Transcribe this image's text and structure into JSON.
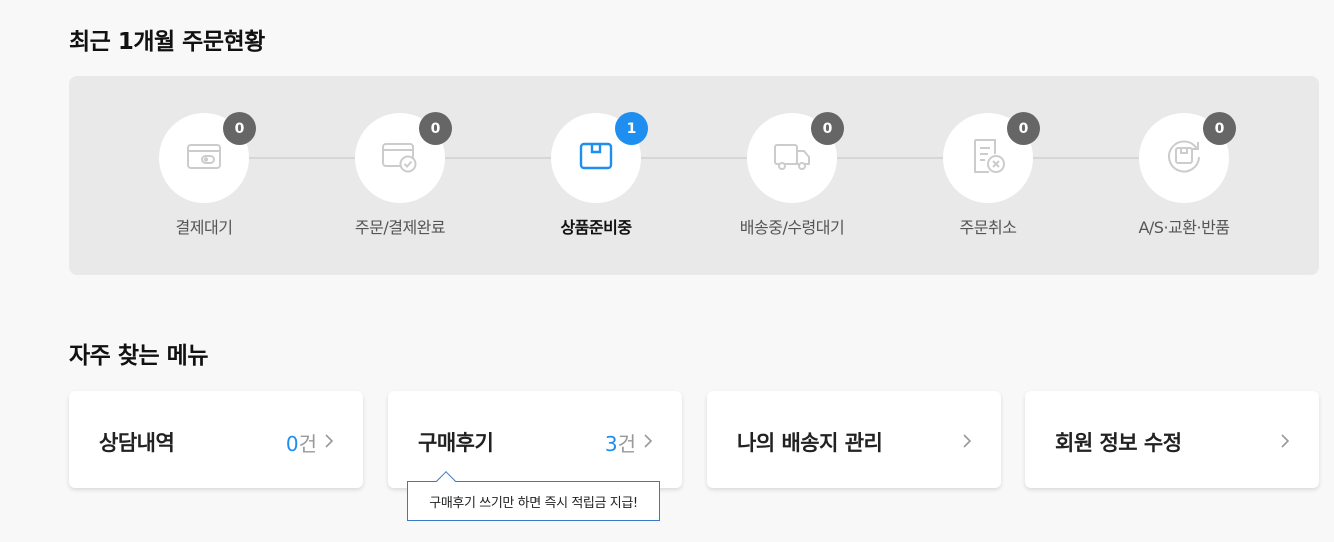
{
  "orders": {
    "title": "최근 1개월 주문현황",
    "steps": [
      {
        "label": "결제대기",
        "count": "0",
        "icon": "wallet-icon",
        "active": false
      },
      {
        "label": "주문/결제완료",
        "count": "0",
        "icon": "payment-complete-icon",
        "active": false
      },
      {
        "label": "상품준비중",
        "count": "1",
        "icon": "box-icon",
        "active": true
      },
      {
        "label": "배송중/수령대기",
        "count": "0",
        "icon": "truck-icon",
        "active": false
      },
      {
        "label": "주문취소",
        "count": "0",
        "icon": "cancel-document-icon",
        "active": false
      },
      {
        "label": "A/S·교환·반품",
        "count": "0",
        "icon": "return-icon",
        "active": false
      }
    ],
    "colors": {
      "active": "#1e8ef0",
      "inactive_badge": "#666666",
      "icon_inactive": "#cccccc"
    }
  },
  "menu": {
    "title": "자주 찾는 메뉴",
    "items": [
      {
        "label": "상담내역",
        "count": "0",
        "unit": "건"
      },
      {
        "label": "구매후기",
        "count": "3",
        "unit": "건"
      },
      {
        "label": "나의 배송지 관리"
      },
      {
        "label": "회원 정보 수정"
      }
    ],
    "review_tooltip": "구매후기 쓰기만 하면 즉시 적립금 지급!"
  }
}
